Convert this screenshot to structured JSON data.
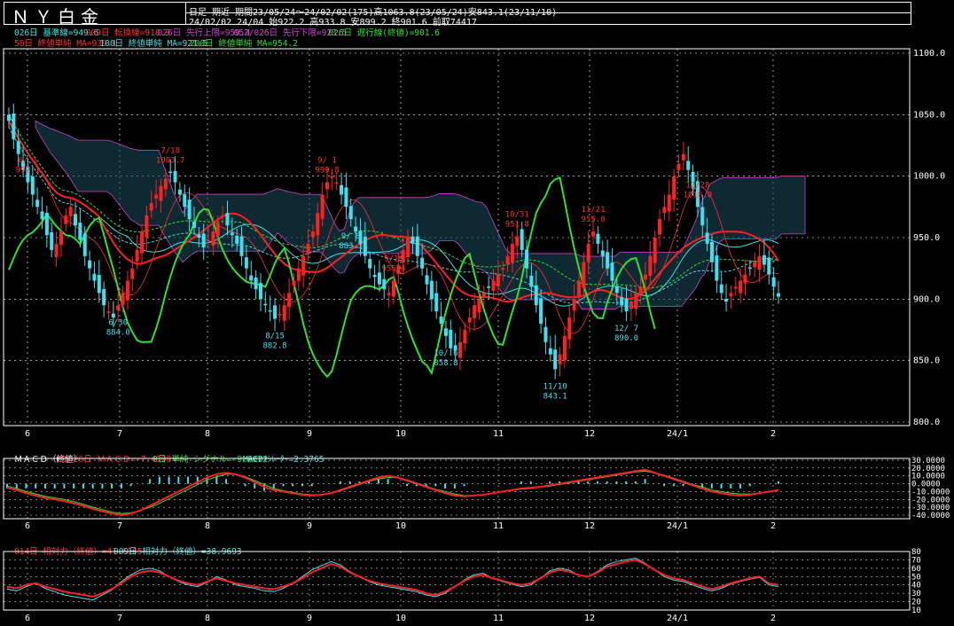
{
  "header": {
    "title": "ＮＹ白金",
    "line1": "日足 期近 期間23/05/24～24/02/02(175)高1063.8(23/05/24)安843.1(23/11/10)",
    "line2": "24/02/02 24/04 始922.2 高933.8 安899.2 終901.6 前取74417"
  },
  "legend": {
    "l1": [
      {
        "text": "026日 基準線=949.6",
        "color": "#40e0e0"
      },
      {
        "text": "009日 転換線=918.3",
        "color": "#ff3030"
      },
      {
        "text": "026日 先行上限=959.4",
        "color": "#d040d0"
      },
      {
        "text": "052/026日 先行下限=923.5",
        "color": "#d040d0"
      },
      {
        "text": "026日 遅行線(終値)=901.6",
        "color": "#30e030"
      }
    ],
    "l2": [
      {
        "text": "50日 終値単純 MA=939.1",
        "color": "#ff3030"
      },
      {
        "text": "100日 終値単純 MA=921.5",
        "color": "#40e0e0"
      },
      {
        "text": "200日 終値単純 MA=954.2",
        "color": "#30e030"
      }
    ],
    "macd": [
      {
        "text": "ＭＡＣＤ（終値）",
        "color": "#ffffff"
      },
      {
        "text": "12-26日 ＭＡＣＤ=-7.4308",
        "color": "#ff3030"
      },
      {
        "text": "9日 単純 シグナル=-9.8072",
        "color": "#30e030"
      },
      {
        "text": "MACDｵｼﾚｰﾀｰ=2.3765",
        "color": "#40e0e0"
      }
    ],
    "rsi": [
      {
        "text": "014日 相対力（終値）=41.6165",
        "color": "#ff3030"
      },
      {
        "text": "009日 相対力（終値）=38.9693",
        "color": "#40e0e0"
      }
    ]
  },
  "colors": {
    "up": "#ff2020",
    "down": "#40e0f0",
    "grid": "#ffffff"
  },
  "chart_data": [
    {
      "type": "candlestick",
      "ylim": [
        800,
        1100
      ],
      "yticks": [
        "1100.0",
        "1050.0",
        "1000.0",
        "950.0",
        "900.0",
        "850.0",
        "800.0"
      ],
      "xticks": [
        "6",
        "7",
        "8",
        "9",
        "10",
        "11",
        "12",
        "24/1",
        "2"
      ],
      "closes": [
        1045,
        1030,
        1018,
        1005,
        995,
        985,
        975,
        965,
        952,
        940,
        945,
        955,
        968,
        975,
        960,
        948,
        935,
        925,
        915,
        905,
        895,
        890,
        885,
        895,
        905,
        915,
        925,
        940,
        955,
        968,
        978,
        985,
        992,
        998,
        1003,
        995,
        985,
        975,
        965,
        958,
        950,
        942,
        948,
        955,
        962,
        968,
        960,
        952,
        945,
        935,
        925,
        915,
        908,
        900,
        895,
        890,
        884,
        888,
        895,
        905,
        915,
        925,
        935,
        945,
        955,
        970,
        985,
        995,
        1000,
        995,
        985,
        975,
        965,
        955,
        945,
        935,
        925,
        918,
        912,
        908,
        905,
        915,
        928,
        940,
        951,
        945,
        935,
        925,
        912,
        900,
        890,
        880,
        870,
        860,
        858,
        865,
        875,
        885,
        895,
        900,
        905,
        910,
        915,
        920,
        925,
        935,
        945,
        951,
        940,
        925,
        910,
        895,
        880,
        865,
        855,
        843,
        855,
        870,
        885,
        900,
        915,
        930,
        945,
        955,
        945,
        935,
        925,
        915,
        905,
        895,
        890,
        898,
        905,
        910,
        920,
        935,
        950,
        965,
        975,
        985,
        1000,
        1010,
        1018,
        1005,
        990,
        975,
        960,
        945,
        930,
        915,
        905,
        898,
        905,
        910,
        915,
        920,
        925,
        930,
        935,
        928,
        920,
        910,
        902
      ],
      "labels": [
        {
          "t": "6/ 1",
          "v": "997.1",
          "i": 4,
          "hi": true
        },
        {
          "t": "6/30",
          "v": "884.0",
          "i": 23,
          "hi": false
        },
        {
          "t": "7/18",
          "v": "1003.7",
          "i": 34,
          "hi": true
        },
        {
          "t": "8/15",
          "v": "882.8",
          "i": 56,
          "hi": false
        },
        {
          "t": "9/ 1",
          "v": "999.8",
          "i": 67,
          "hi": true
        },
        {
          "t": "9/ 8",
          "v": "883.3",
          "i": 72,
          "hi": false
        },
        {
          "t": "9/19",
          "v": "955.4",
          "i": 81,
          "hi": true
        },
        {
          "t": "10/ 6",
          "v": "858.8",
          "i": 92,
          "hi": false
        },
        {
          "t": "10/31",
          "v": "951.8",
          "i": 107,
          "hi": true
        },
        {
          "t": "11/10",
          "v": "843.1",
          "i": 115,
          "hi": false
        },
        {
          "t": "11/21",
          "v": "955.8",
          "i": 123,
          "hi": true
        },
        {
          "t": "12/ 7",
          "v": "890.0",
          "i": 130,
          "hi": false
        },
        {
          "t": "12/28",
          "v": "1018.0",
          "i": 145,
          "hi": true
        }
      ]
    },
    {
      "type": "macd",
      "ylim": [
        -40,
        30
      ],
      "yticks": [
        "30.0000",
        "20.0000",
        "10.0000",
        "0.0000",
        "-10.0000",
        "-20.0000",
        "-30.0000",
        "-40.0000"
      ],
      "macd": [
        -5,
        -8,
        -12,
        -15,
        -18,
        -20,
        -22,
        -25,
        -28,
        -32,
        -35,
        -38,
        -40,
        -38,
        -34,
        -28,
        -22,
        -16,
        -10,
        -4,
        2,
        8,
        12,
        14,
        12,
        8,
        2,
        -4,
        -8,
        -10,
        -12,
        -14,
        -15,
        -14,
        -12,
        -8,
        -4,
        0,
        4,
        8,
        10,
        8,
        4,
        0,
        -4,
        -8,
        -12,
        -15,
        -16,
        -15,
        -14,
        -12,
        -10,
        -8,
        -6,
        -5,
        -4,
        -2,
        0,
        2,
        4,
        6,
        8,
        10,
        12,
        14,
        16,
        18,
        14,
        10,
        6,
        2,
        -2,
        -6,
        -10,
        -12,
        -14,
        -15,
        -14,
        -12,
        -10,
        -8
      ],
      "signal": [
        -3,
        -6,
        -10,
        -13,
        -16,
        -18,
        -20,
        -23,
        -26,
        -30,
        -33,
        -36,
        -38,
        -37,
        -34,
        -30,
        -25,
        -19,
        -13,
        -7,
        -1,
        5,
        9,
        12,
        12,
        9,
        4,
        -1,
        -6,
        -9,
        -11,
        -13,
        -14,
        -14,
        -12,
        -9,
        -5,
        -1,
        3,
        6,
        8,
        8,
        5,
        1,
        -3,
        -7,
        -10,
        -13,
        -15,
        -15,
        -14,
        -12,
        -10,
        -8,
        -7,
        -6,
        -4,
        -3,
        -1,
        1,
        3,
        5,
        7,
        9,
        11,
        13,
        15,
        16,
        14,
        11,
        7,
        3,
        -1,
        -4,
        -8,
        -10,
        -12,
        -13,
        -13,
        -12,
        -10,
        -9
      ]
    },
    {
      "type": "rsi",
      "ylim": [
        10,
        80
      ],
      "yticks": [
        "80",
        "70",
        "60",
        "50",
        "40",
        "30",
        "20",
        "10"
      ],
      "rsi14": [
        38,
        36,
        40,
        42,
        38,
        35,
        32,
        30,
        28,
        26,
        30,
        35,
        42,
        50,
        55,
        57,
        55,
        50,
        45,
        42,
        40,
        44,
        48,
        45,
        42,
        40,
        38,
        36,
        35,
        38,
        42,
        48,
        55,
        60,
        65,
        62,
        55,
        50,
        45,
        42,
        40,
        38,
        36,
        34,
        30,
        28,
        32,
        38,
        45,
        50,
        52,
        48,
        45,
        42,
        40,
        42,
        48,
        55,
        58,
        56,
        52,
        50,
        55,
        62,
        65,
        68,
        70,
        65,
        58,
        52,
        48,
        46,
        42,
        38,
        35,
        38,
        42,
        45,
        48,
        50,
        42,
        40
      ],
      "rsi9": [
        35,
        33,
        38,
        42,
        36,
        32,
        28,
        26,
        24,
        22,
        28,
        34,
        44,
        52,
        58,
        60,
        57,
        50,
        44,
        40,
        38,
        43,
        50,
        46,
        40,
        38,
        36,
        33,
        32,
        36,
        42,
        50,
        58,
        63,
        68,
        64,
        56,
        50,
        44,
        40,
        38,
        36,
        34,
        32,
        28,
        26,
        30,
        38,
        46,
        52,
        54,
        48,
        44,
        41,
        38,
        40,
        48,
        57,
        60,
        58,
        52,
        50,
        56,
        64,
        68,
        70,
        72,
        66,
        58,
        50,
        46,
        44,
        40,
        36,
        33,
        36,
        41,
        44,
        47,
        49,
        40,
        38
      ]
    }
  ]
}
